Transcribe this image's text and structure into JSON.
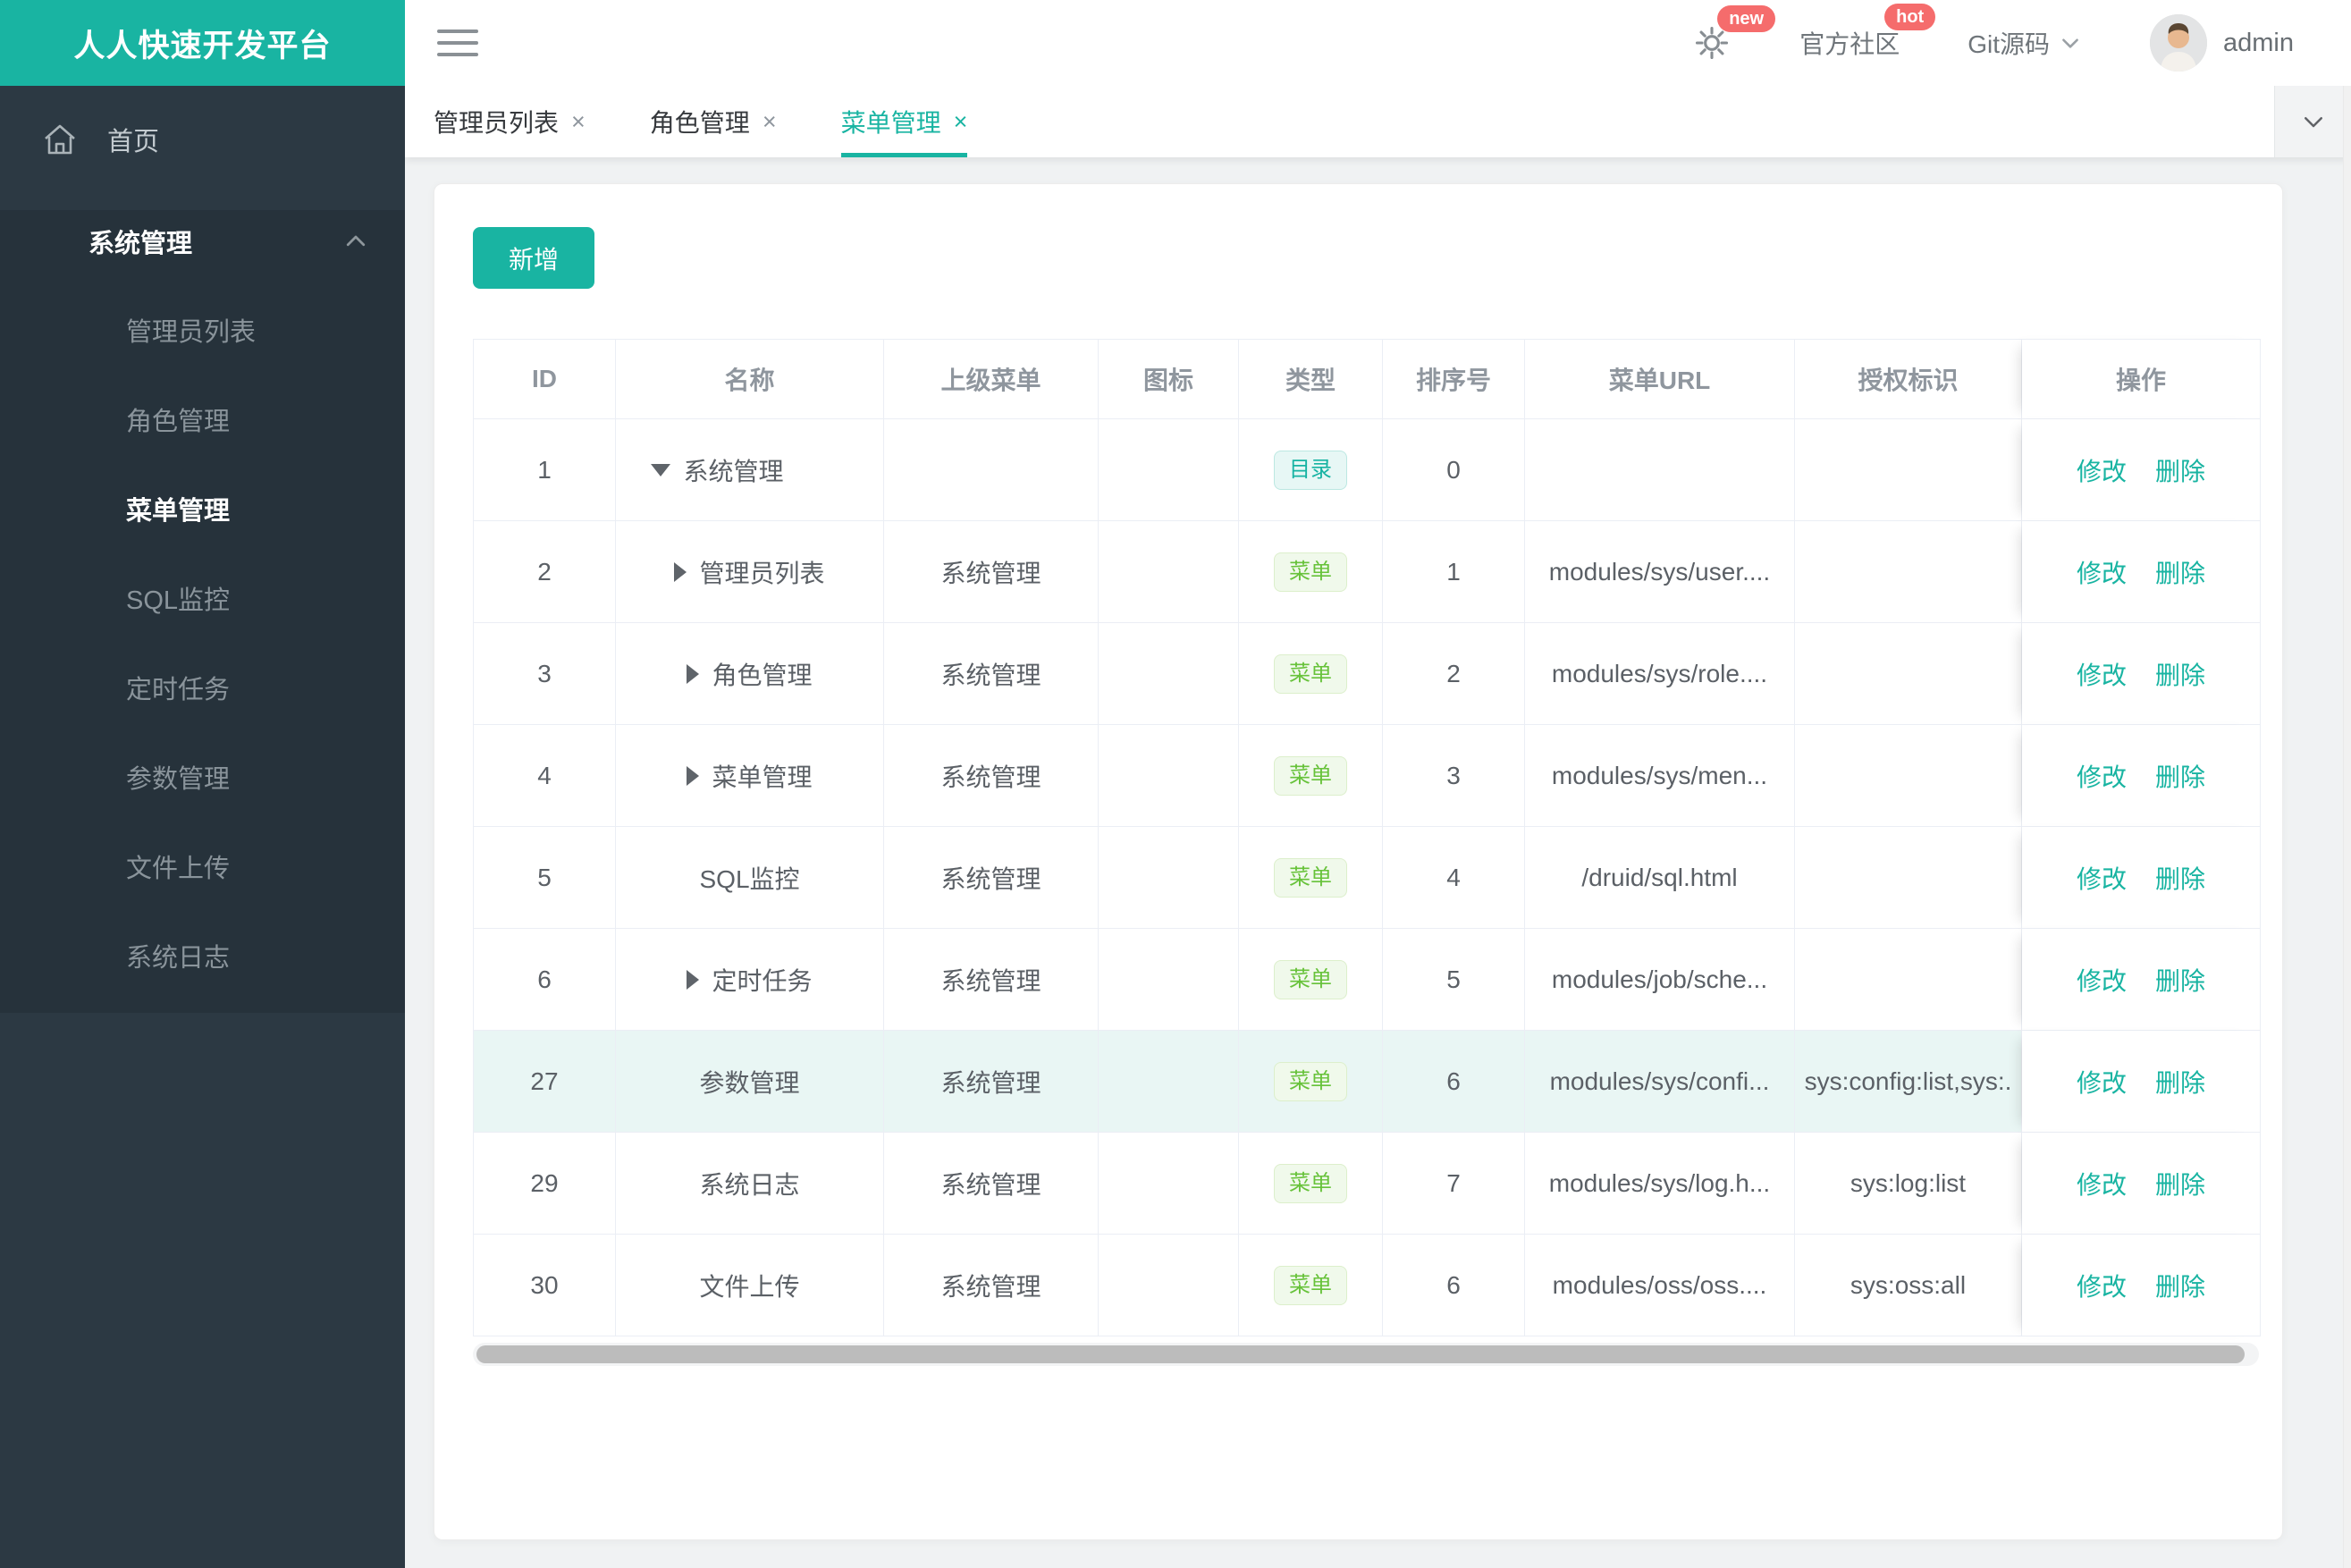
{
  "app": {
    "title": "人人快速开发平台"
  },
  "colors": {
    "accent_teal": "#19b4a2",
    "badge_red": "#f56c6c",
    "tag_dir_teal": "#17b3a3",
    "tag_menu_green": "#67c23a",
    "sidebar_bg": "#2c3943",
    "submenu_bg": "#26323b",
    "row_highlight": "#e9f6f4"
  },
  "topnav": {
    "badge_new": "new",
    "community_label": "官方社区",
    "badge_hot": "hot",
    "git_label": "Git源码",
    "username": "admin"
  },
  "sidebar": {
    "home_label": "首页",
    "group": {
      "label": "系统管理",
      "active_item": "菜单管理",
      "items": [
        {
          "label": "管理员列表"
        },
        {
          "label": "角色管理"
        },
        {
          "label": "菜单管理"
        },
        {
          "label": "SQL监控"
        },
        {
          "label": "定时任务"
        },
        {
          "label": "参数管理"
        },
        {
          "label": "文件上传"
        },
        {
          "label": "系统日志"
        }
      ]
    }
  },
  "tabbar": {
    "active_tab": "菜单管理",
    "tabs": [
      {
        "label": "管理员列表"
      },
      {
        "label": "角色管理"
      },
      {
        "label": "菜单管理"
      }
    ]
  },
  "toolbar": {
    "add_label": "新增"
  },
  "table": {
    "columns": [
      "ID",
      "名称",
      "上级菜单",
      "图标",
      "类型",
      "排序号",
      "菜单URL",
      "授权标识",
      "操作"
    ],
    "edit_label": "修改",
    "delete_label": "删除",
    "rows": [
      {
        "id": "1",
        "name": "系统管理",
        "caret": "down",
        "indent": 0,
        "parent": "",
        "icon": "",
        "type": "目录",
        "order": "0",
        "url": "",
        "perms": "",
        "highlighted": false
      },
      {
        "id": "2",
        "name": "管理员列表",
        "caret": "right",
        "indent": 1,
        "parent": "系统管理",
        "icon": "",
        "type": "菜单",
        "order": "1",
        "url": "modules/sys/user....",
        "perms": "",
        "highlighted": false
      },
      {
        "id": "3",
        "name": "角色管理",
        "caret": "right",
        "indent": 1,
        "parent": "系统管理",
        "icon": "",
        "type": "菜单",
        "order": "2",
        "url": "modules/sys/role....",
        "perms": "",
        "highlighted": false
      },
      {
        "id": "4",
        "name": "菜单管理",
        "caret": "right",
        "indent": 1,
        "parent": "系统管理",
        "icon": "",
        "type": "菜单",
        "order": "3",
        "url": "modules/sys/men...",
        "perms": "",
        "highlighted": false
      },
      {
        "id": "5",
        "name": "SQL监控",
        "caret": "",
        "indent": 1,
        "parent": "系统管理",
        "icon": "",
        "type": "菜单",
        "order": "4",
        "url": "/druid/sql.html",
        "perms": "",
        "highlighted": false
      },
      {
        "id": "6",
        "name": "定时任务",
        "caret": "right",
        "indent": 1,
        "parent": "系统管理",
        "icon": "",
        "type": "菜单",
        "order": "5",
        "url": "modules/job/sche...",
        "perms": "",
        "highlighted": false
      },
      {
        "id": "27",
        "name": "参数管理",
        "caret": "",
        "indent": 1,
        "parent": "系统管理",
        "icon": "",
        "type": "菜单",
        "order": "6",
        "url": "modules/sys/confi...",
        "perms": "sys:config:list,sys:.",
        "highlighted": true
      },
      {
        "id": "29",
        "name": "系统日志",
        "caret": "",
        "indent": 1,
        "parent": "系统管理",
        "icon": "",
        "type": "菜单",
        "order": "7",
        "url": "modules/sys/log.h...",
        "perms": "sys:log:list",
        "highlighted": false
      },
      {
        "id": "30",
        "name": "文件上传",
        "caret": "",
        "indent": 1,
        "parent": "系统管理",
        "icon": "",
        "type": "菜单",
        "order": "6",
        "url": "modules/oss/oss....",
        "perms": "sys:oss:all",
        "highlighted": false
      }
    ]
  }
}
